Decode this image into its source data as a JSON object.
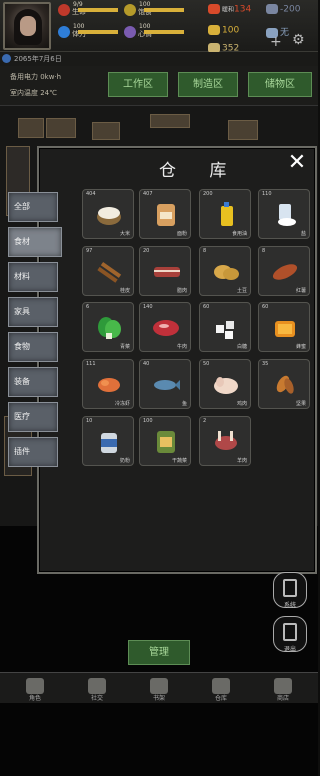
{
  "hud": {
    "stats": [
      {
        "label": "生命",
        "value": "9/9",
        "fill": 1.0,
        "color": "#c0392b"
      },
      {
        "label": "体力",
        "value": "100",
        "fill": 1.0,
        "color": "#2e7dd7"
      },
      {
        "label": "饱食",
        "value": "100",
        "fill": 1.0,
        "color": "#b59a2a"
      },
      {
        "label": "心情",
        "value": "100",
        "fill": 1.0,
        "color": "#7a5bb0"
      }
    ],
    "resources": [
      {
        "name": "fire-icon",
        "label": "暖和",
        "value": "134",
        "color": "#d84a2a"
      },
      {
        "name": "temp-icon",
        "label": "",
        "value": "-200",
        "color": "#7a86a0"
      },
      {
        "name": "hunger-icon",
        "label": "",
        "value": "100",
        "color": "#d8b03a"
      },
      {
        "name": "clean-icon",
        "label": "",
        "value": "无",
        "color": "#8aa2c0"
      },
      {
        "name": "coin-icon",
        "label": "",
        "value": "352",
        "color": "#c9b370"
      }
    ],
    "add_label": "+",
    "date": "2065年7月6日",
    "power": "备用电力 0kw·h",
    "indoor_temp": "室内温度 24℃",
    "buttons": [
      "工作区",
      "制造区",
      "储物区"
    ]
  },
  "panel": {
    "title": "仓 库",
    "close_label": "✕",
    "tabs": [
      "全部",
      "食材",
      "材料",
      "家具",
      "食物",
      "装备",
      "医疗",
      "插件"
    ],
    "active_tab": 1,
    "items": [
      {
        "count": "404",
        "name": "大米",
        "art": "rice"
      },
      {
        "count": "407",
        "name": "面粉",
        "art": "flour"
      },
      {
        "count": "200",
        "name": "食用油",
        "art": "oil"
      },
      {
        "count": "110",
        "name": "盐",
        "art": "salt"
      },
      {
        "count": "97",
        "name": "桂皮",
        "art": "cinnamon"
      },
      {
        "count": "20",
        "name": "腊肉",
        "art": "bacon"
      },
      {
        "count": "8",
        "name": "土豆",
        "art": "potato"
      },
      {
        "count": "8",
        "name": "红薯",
        "art": "sweetpotato"
      },
      {
        "count": "6",
        "name": "青菜",
        "art": "greens"
      },
      {
        "count": "140",
        "name": "牛肉",
        "art": "beef"
      },
      {
        "count": "60",
        "name": "白糖",
        "art": "sugar"
      },
      {
        "count": "60",
        "name": "蜂蜜",
        "art": "honey"
      },
      {
        "count": "111",
        "name": "冷冻虾",
        "art": "shrimp"
      },
      {
        "count": "40",
        "name": "鱼",
        "art": "fish"
      },
      {
        "count": "50",
        "name": "鸡肉",
        "art": "chicken"
      },
      {
        "count": "35",
        "name": "坚果",
        "art": "nuts"
      },
      {
        "count": "10",
        "name": "奶粉",
        "art": "milk"
      },
      {
        "count": "100",
        "name": "干蔬菜",
        "art": "vegbag"
      },
      {
        "count": "2",
        "name": "羊肉",
        "art": "mutton"
      }
    ]
  },
  "side": {
    "btn1": "系统",
    "btn2": "退出"
  },
  "bottom": {
    "manage_label": "管理",
    "nav": [
      "角色",
      "社交",
      "书架",
      "仓库",
      "商店"
    ]
  }
}
